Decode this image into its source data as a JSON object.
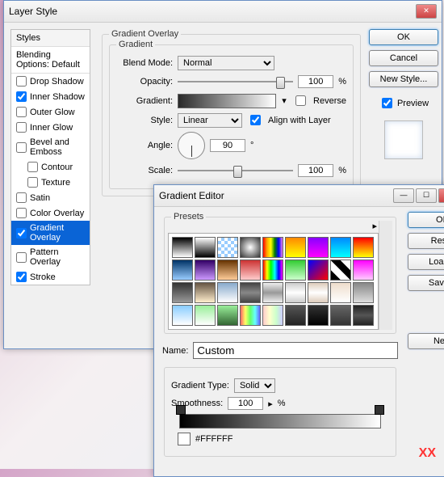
{
  "layerStyle": {
    "title": "Layer Style",
    "stylesHeader": "Styles",
    "blendingDefault": "Blending Options: Default",
    "items": [
      {
        "label": "Drop Shadow",
        "checked": false
      },
      {
        "label": "Inner Shadow",
        "checked": true
      },
      {
        "label": "Outer Glow",
        "checked": false
      },
      {
        "label": "Inner Glow",
        "checked": false
      },
      {
        "label": "Bevel and Emboss",
        "checked": false
      },
      {
        "label": "Contour",
        "checked": false,
        "indent": true
      },
      {
        "label": "Texture",
        "checked": false,
        "indent": true
      },
      {
        "label": "Satin",
        "checked": false
      },
      {
        "label": "Color Overlay",
        "checked": false
      },
      {
        "label": "Gradient Overlay",
        "checked": true,
        "selected": true
      },
      {
        "label": "Pattern Overlay",
        "checked": false
      },
      {
        "label": "Stroke",
        "checked": true
      }
    ],
    "section": "Gradient Overlay",
    "subsection": "Gradient",
    "blendModeLbl": "Blend Mode:",
    "blendMode": "Normal",
    "opacityLbl": "Opacity:",
    "opacity": "100",
    "gradientLbl": "Gradient:",
    "reverse": "Reverse",
    "styleLbl": "Style:",
    "style": "Linear",
    "align": "Align with Layer",
    "angleLbl": "Angle:",
    "angle": "90",
    "scaleLbl": "Scale:",
    "scale": "100",
    "pct": "%",
    "deg": "°",
    "ok": "OK",
    "cancel": "Cancel",
    "newStyle": "New Style...",
    "preview": "Preview"
  },
  "gradEditor": {
    "title": "Gradient Editor",
    "presets": "Presets",
    "ok": "OK",
    "reset": "Reset",
    "load": "Load...",
    "save": "Save...",
    "nameLbl": "Name:",
    "name": "Custom",
    "new": "New",
    "typeLbl": "Gradient Type:",
    "type": "Solid",
    "smoothLbl": "Smoothness:",
    "smooth": "100",
    "pct": "%",
    "hex": "#FFFFFF"
  },
  "watermark": "XX",
  "swatches": [
    "linear-gradient(#000,#fff)",
    "linear-gradient(#fff,#000)",
    "repeating-conic-gradient(#9cf 0 25%,#fff 0 50%) 0/8px 8px",
    "radial-gradient(#fff,#333)",
    "linear-gradient(90deg,red,orange,yellow,green,blue,violet)",
    "linear-gradient(#f80,#ff0)",
    "linear-gradient(#80f,#f0f)",
    "linear-gradient(#08f,#0ff)",
    "linear-gradient(#f00,#ff0)",
    "linear-gradient(#036,#9cf)",
    "linear-gradient(#306,#c9f)",
    "linear-gradient(#630,#fc9)",
    "linear-gradient(#c33,#fcc)",
    "linear-gradient(90deg,#f00,#ff0,#0f0,#0ff,#00f,#f0f)",
    "linear-gradient(#3c3,#cfc)",
    "linear-gradient(135deg,#00f,#f00)",
    "linear-gradient(45deg,#000 25%,#fff 25%,#fff 50%,#000 50%,#000 75%,#fff 75%)",
    "linear-gradient(#f0f,#fcf)",
    "linear-gradient(#333,#999)",
    "linear-gradient(#654,#fec)",
    "linear-gradient(#8ac,#fff)",
    "linear-gradient(#444,#888,#444)",
    "linear-gradient(#eee,#999,#eee)",
    "linear-gradient(#ccc,#fff,#ccc)",
    "linear-gradient(#dcb,#fff,#dcb)",
    "linear-gradient(#edc,#fff)",
    "linear-gradient(#888,#ddd)",
    "linear-gradient(#8cf,#fff)",
    "linear-gradient(#9e9,#fff)",
    "linear-gradient(#9e9,#363)",
    "linear-gradient(90deg,#f66,#ff6,#6f6,#6ff,#66f)",
    "linear-gradient(90deg,#fcc,#ffc,#cfc,#ccf)",
    "linear-gradient(#555,#222)",
    "linear-gradient(#333,#000)",
    "linear-gradient(#666,#333)",
    "linear-gradient(#222,#555,#222)"
  ]
}
